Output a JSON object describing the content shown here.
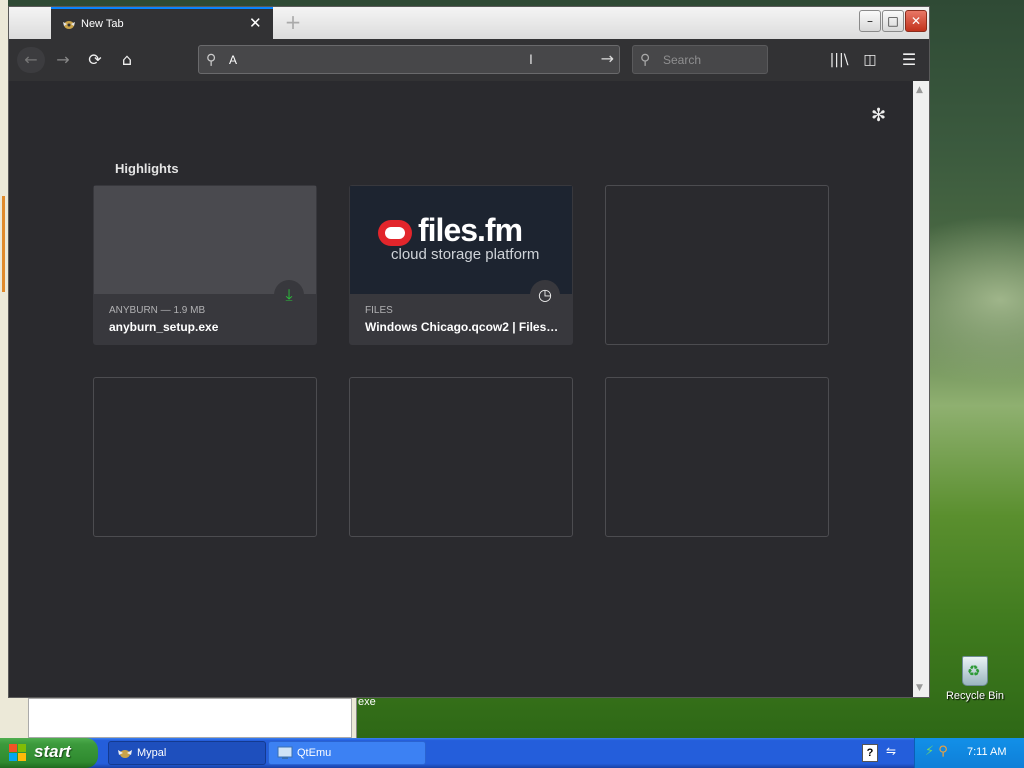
{
  "browser": {
    "tab": {
      "title": "New Tab",
      "close": "✕"
    },
    "new_tab_symbol": "+",
    "window_buttons": {
      "minimize": "–",
      "maximize": "□",
      "close": "✕"
    },
    "nav": {
      "back": "←",
      "forward": "→",
      "reload": "⟳",
      "home": "⌂"
    },
    "urlbar": {
      "value": "A",
      "go": "→"
    },
    "searchbar": {
      "placeholder": "Search"
    },
    "toolbar": {
      "library": "|||\\",
      "sidebar": "◫",
      "menu": "☰"
    }
  },
  "newtab": {
    "settings_icon": "✻",
    "highlights_title": "Highlights",
    "cards": [
      {
        "meta": "ANYBURN — 1.9 MB",
        "title": "anyburn_setup.exe",
        "badge": "⤓",
        "badge_type": "download-icon"
      },
      {
        "meta": "FILES",
        "title": "Windows Chicago.qcow2 | Files.fm",
        "badge": "◷",
        "badge_type": "clock-icon",
        "logo_text": "files.fm",
        "logo_sub": "cloud storage platform",
        "logo_color": "#e2252b"
      }
    ]
  },
  "desktop": {
    "recycle_bin_label": "Recycle Bin",
    "bg_window_label": "exe"
  },
  "taskbar": {
    "start_label": "start",
    "tasks": [
      {
        "label": "Mypal",
        "active": true
      },
      {
        "label": "QtEmu",
        "active": false
      }
    ],
    "help_symbol": "?",
    "tray_arrow": "⇋",
    "clock": "7:11 AM"
  },
  "colors": {
    "accent": "#0a84ff",
    "newtab_bg": "#2a2a2e",
    "taskbar": "#245edb",
    "start": "#3c9a3c"
  }
}
